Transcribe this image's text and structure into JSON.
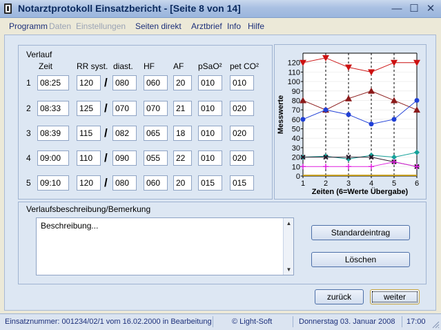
{
  "window": {
    "title": "Notarztprotokoll Einsatzbericht - [Seite 8 von 14]",
    "minimize_glyph": "—",
    "maximize_glyph": "☐",
    "close_glyph": "✕"
  },
  "menu": [
    {
      "label": "Programm",
      "disabled": false
    },
    {
      "label": "Daten",
      "disabled": true
    },
    {
      "label": "Einstellungen",
      "disabled": true
    },
    {
      "label": "Seiten direkt",
      "disabled": false
    },
    {
      "label": "Arztbrief",
      "disabled": false
    },
    {
      "label": "Info",
      "disabled": false
    },
    {
      "label": "Hilfe",
      "disabled": false
    }
  ],
  "verlauf": {
    "title": "Verlauf",
    "headers": {
      "zeit": "Zeit",
      "rr_syst": "RR syst.",
      "diast": "diast.",
      "hf": "HF",
      "af": "AF",
      "psao2": "pSaO²",
      "petco2": "pet CO²"
    },
    "slash": "/",
    "rows": [
      {
        "num": "1",
        "zeit": "08:25",
        "syst": "120",
        "diast": "080",
        "hf": "060",
        "af": "20",
        "psao2": "010",
        "petco2": "010"
      },
      {
        "num": "2",
        "zeit": "08:33",
        "syst": "125",
        "diast": "070",
        "hf": "070",
        "af": "21",
        "psao2": "010",
        "petco2": "020"
      },
      {
        "num": "3",
        "zeit": "08:39",
        "syst": "115",
        "diast": "082",
        "hf": "065",
        "af": "18",
        "psao2": "010",
        "petco2": "020"
      },
      {
        "num": "4",
        "zeit": "09:00",
        "syst": "110",
        "diast": "090",
        "hf": "055",
        "af": "22",
        "psao2": "010",
        "petco2": "020"
      },
      {
        "num": "5",
        "zeit": "09:10",
        "syst": "120",
        "diast": "080",
        "hf": "060",
        "af": "20",
        "psao2": "015",
        "petco2": "015"
      }
    ]
  },
  "chart_data": {
    "type": "line",
    "ylabel": "Messwerte",
    "xlabel": "Zeiten (6=Werte Übergabe)",
    "x": [
      1,
      2,
      3,
      4,
      5,
      6
    ],
    "xlim": [
      1,
      6
    ],
    "ylim": [
      0,
      130
    ],
    "yticks": [
      0,
      10,
      20,
      30,
      40,
      50,
      60,
      70,
      80,
      90,
      100,
      110,
      120
    ],
    "grid": "vertical dashed",
    "series": [
      {
        "values": [
          120,
          125,
          115,
          110,
          120,
          120
        ],
        "color": "#cc1111",
        "marker": "triangle-down"
      },
      {
        "values": [
          80,
          70,
          82,
          90,
          80,
          70
        ],
        "color": "#8b1a1a",
        "marker": "triangle-up"
      },
      {
        "values": [
          60,
          70,
          65,
          55,
          60,
          80
        ],
        "color": "#1f3fd6",
        "marker": "circle"
      },
      {
        "values": [
          20,
          21,
          18,
          22,
          20,
          25
        ],
        "color": "#17a29a",
        "marker": "diamond"
      },
      {
        "values": [
          20,
          20,
          20,
          20,
          15,
          10
        ],
        "color": "#2a1a2a",
        "marker": "x"
      },
      {
        "values": [
          10,
          10,
          10,
          10,
          15,
          10
        ],
        "color": "#e020e0",
        "marker": "plus"
      }
    ]
  },
  "description": {
    "title": "Verlaufsbeschreibung/Bemerkung",
    "text": "Beschreibung..."
  },
  "buttons": {
    "standard": "Standardeintrag",
    "loeschen": "Löschen",
    "zurueck": "zurück",
    "weiter": "weiter"
  },
  "status": {
    "einsatz": "Einsatznummer: 001234/02/1 vom 16.02.2000 in Bearbeitung",
    "copyright": "© Light-Soft",
    "date": "Donnerstag  03. Januar 2008",
    "time": "17:00"
  }
}
